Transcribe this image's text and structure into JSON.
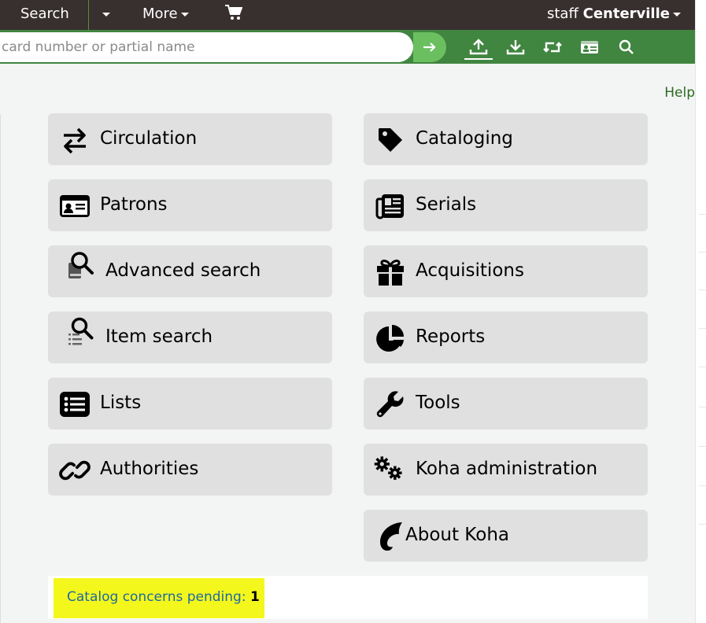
{
  "nav": {
    "search": "Search",
    "more": "More",
    "user_prefix": "staff",
    "branch": "Centerville"
  },
  "searchbar": {
    "placeholder": "card number or partial name"
  },
  "help": "Help",
  "tiles": {
    "circulation": "Circulation",
    "patrons": "Patrons",
    "advanced_search": "Advanced search",
    "item_search": "Item search",
    "lists": "Lists",
    "authorities": "Authorities",
    "cataloging": "Cataloging",
    "serials": "Serials",
    "acquisitions": "Acquisitions",
    "reports": "Reports",
    "tools": "Tools",
    "koha_administration": "Koha administration",
    "about_koha": "About Koha"
  },
  "concerns": {
    "label": "Catalog concerns pending:",
    "count": "1"
  }
}
